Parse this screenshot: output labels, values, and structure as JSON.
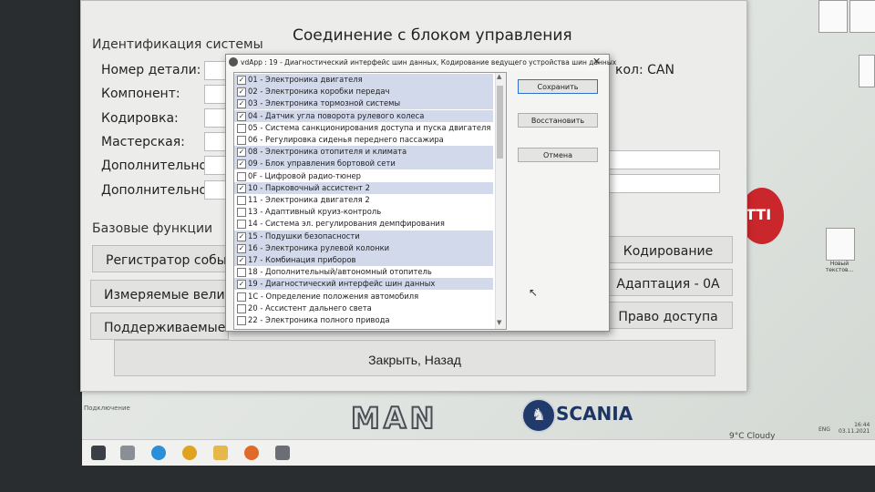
{
  "main": {
    "title": "Соединение с блоком управления",
    "identification_heading": "Идентификация системы",
    "fields": [
      {
        "label": "Номер детали:"
      },
      {
        "label": "Компонент:"
      },
      {
        "label": "Кодировка:"
      },
      {
        "label": "Мастерская:"
      },
      {
        "label": "Дополнительно:"
      },
      {
        "label": "Дополнительно:"
      }
    ],
    "protocol": "кол: CAN",
    "base_functions_heading": "Базовые функции",
    "left_buttons": [
      "Регистратор событи",
      "Измеряемые величи",
      "Поддерживаемые ко"
    ],
    "right_buttons": [
      "Кодирование",
      "Адаптация - 0A",
      "Право доступа"
    ],
    "close_button": "Закрыть, Назад",
    "status_label": "Подключение"
  },
  "dialog": {
    "title": "vdApp : 19 - Диагностический интерфейс шин данных,  Кодирование ведущего устройства шин данных",
    "close_glyph": "✕",
    "buttons": {
      "save": "Сохранить",
      "restore": "Восстановить",
      "cancel": "Отмена"
    },
    "items": [
      {
        "code": "01",
        "name": "Электроника двигателя",
        "checked": true
      },
      {
        "code": "02",
        "name": "Электроника коробки передач",
        "checked": true
      },
      {
        "code": "03",
        "name": "Электроника тормозной системы",
        "checked": true
      },
      {
        "code": "04",
        "name": "Датчик угла поворота рулевого колеса",
        "checked": true
      },
      {
        "code": "05",
        "name": "Система санкционирования доступа и пуска двигателя",
        "checked": false
      },
      {
        "code": "06",
        "name": "Регулировка сиденья переднего пассажира",
        "checked": false
      },
      {
        "code": "08",
        "name": "Электроника отопителя и климата",
        "checked": true
      },
      {
        "code": "09",
        "name": "Блок управления бортовой сети",
        "checked": true
      },
      {
        "code": "0F",
        "name": "Цифровой радио-тюнер",
        "checked": false
      },
      {
        "code": "10",
        "name": "Парковочный ассистент 2",
        "checked": true
      },
      {
        "code": "11",
        "name": "Электроника двигателя 2",
        "checked": false
      },
      {
        "code": "13",
        "name": "Адаптивный круиз-контроль",
        "checked": false
      },
      {
        "code": "14",
        "name": "Система эл. регулирования демпфирования",
        "checked": false
      },
      {
        "code": "15",
        "name": "Подушки безопасности",
        "checked": true
      },
      {
        "code": "16",
        "name": "Электроника рулевой колонки",
        "checked": true
      },
      {
        "code": "17",
        "name": "Комбинация приборов",
        "checked": true
      },
      {
        "code": "18",
        "name": "Дополнительный/автономный отопитель",
        "checked": false
      },
      {
        "code": "19",
        "name": "Диагностический интерфейс шин данных",
        "checked": true
      },
      {
        "code": "1C",
        "name": "Определение положения автомобиля",
        "checked": false
      },
      {
        "code": "20",
        "name": "Ассистент дальнего света",
        "checked": false
      },
      {
        "code": "22",
        "name": "Электроника полного привода",
        "checked": false
      }
    ]
  },
  "desktop": {
    "brands": {
      "man": "MAN",
      "scania": "SCANIA",
      "emblem": "TTI"
    },
    "icon_label": "Новый текстов..."
  },
  "taskbar": {
    "weather": "9°C Cloudy",
    "language": "ENG",
    "time": "16:44",
    "date": "03.11.2021"
  },
  "colors": {
    "selection": "#d2d9ea",
    "focus": "#2f6fc9",
    "scania_blue": "#1d3563",
    "emblem_red": "#c9272b"
  }
}
